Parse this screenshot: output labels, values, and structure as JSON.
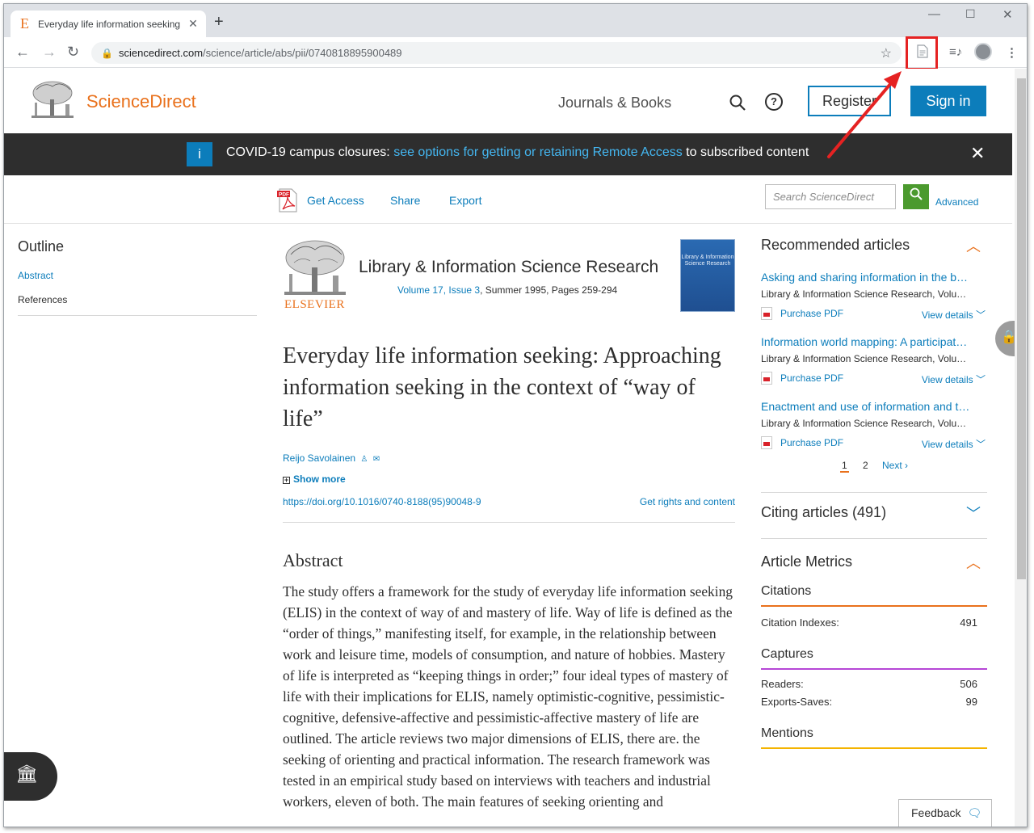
{
  "browser": {
    "tab_title": "Everyday life information seeking",
    "tab_favicon": "E",
    "url_host": "sciencedirect.com",
    "url_path": "/science/article/abs/pii/0740818895900489"
  },
  "header": {
    "brand": "ScienceDirect",
    "journals_books": "Journals & Books",
    "help": "?",
    "register": "Register",
    "signin": "Sign in"
  },
  "covid": {
    "info": "i",
    "lead": "COVID-19 campus closures: ",
    "link": "see options for getting or retaining Remote Access",
    "tail": " to subscribed content"
  },
  "article_toolbar": {
    "get_access": "Get Access",
    "share": "Share",
    "export": "Export",
    "search_placeholder": "Search ScienceDirect",
    "advanced": "Advanced"
  },
  "outline": {
    "heading": "Outline",
    "items": [
      "Abstract",
      "References"
    ]
  },
  "article": {
    "publisher": "ELSEVIER",
    "journal": "Library & Information Science Research",
    "volume_issue": "Volume 17, Issue 3",
    "date_pages": ", Summer 1995, Pages 259-294",
    "cover_text": "Library & Information Science Research",
    "title": "Everyday life information seeking: Approaching information seeking in the context of “way of life”",
    "author": "Reijo Savolainen",
    "show_more": "Show more",
    "doi": "https://doi.org/10.1016/0740-8188(95)90048-9",
    "rights": "Get rights and content",
    "abstract_heading": "Abstract",
    "abstract_text": "The study offers a framework for the study of everyday life information seeking (ELIS) in the context of way of and mastery of life. Way of life is defined as the “order of things,” manifesting itself, for example, in the relationship between work and leisure time, models of consumption, and nature of hobbies. Mastery of life is interpreted as “keeping things in order;” four ideal types of mastery of life with their implications for ELIS, namely optimistic-cognitive, pessimistic-cognitive, defensive-affective and pessimistic-affective mastery of life are outlined. The article reviews two major dimensions of ELIS, there are. the seeking of orienting and practical information. The research framework was tested in an empirical study based on interviews with teachers and industrial workers, eleven of both. The main features of seeking orienting and"
  },
  "recommended": {
    "heading": "Recommended articles",
    "items": [
      {
        "title": "Asking and sharing information in the b…",
        "journal": "Library & Information Science Research, Volu…",
        "pdf": "Purchase PDF",
        "details": "View details"
      },
      {
        "title": "Information world mapping: A participat…",
        "journal": "Library & Information Science Research, Volu…",
        "pdf": "Purchase PDF",
        "details": "View details"
      },
      {
        "title": "Enactment and use of information and t…",
        "journal": "Library & Information Science Research, Volu…",
        "pdf": "Purchase PDF",
        "details": "View details"
      }
    ],
    "pages": [
      "1",
      "2"
    ],
    "next": "Next"
  },
  "citing": {
    "heading": "Citing articles (491)"
  },
  "metrics": {
    "heading": "Article Metrics",
    "citations": {
      "heading": "Citations",
      "label": "Citation Indexes:",
      "value": "491",
      "color": "#e9711c"
    },
    "captures": {
      "heading": "Captures",
      "readers_label": "Readers:",
      "readers": "506",
      "exports_label": "Exports-Saves:",
      "exports": "99",
      "color": "#b646d6"
    },
    "mentions": {
      "heading": "Mentions",
      "color": "#f4b400"
    }
  },
  "feedback": "Feedback",
  "icons": {
    "annotation_color": "#e52222",
    "link_color": "#0c7dbb",
    "brand_color": "#e9711c"
  }
}
